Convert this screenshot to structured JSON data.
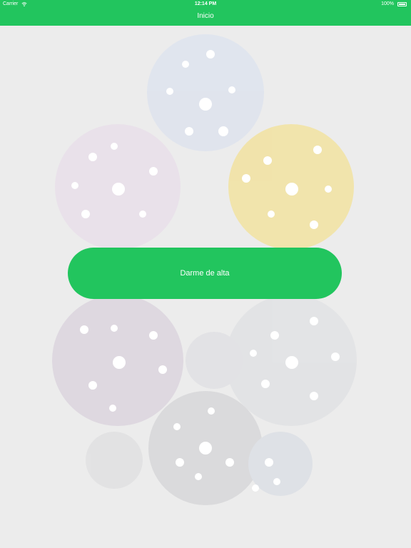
{
  "status_bar": {
    "carrier": "Carrier",
    "time": "12:14 PM",
    "battery": "100%"
  },
  "nav": {
    "title": "Inicio"
  },
  "main": {
    "signup_label": "Darme de alta"
  },
  "colors": {
    "accent": "#22c55e",
    "background": "#ececec"
  }
}
